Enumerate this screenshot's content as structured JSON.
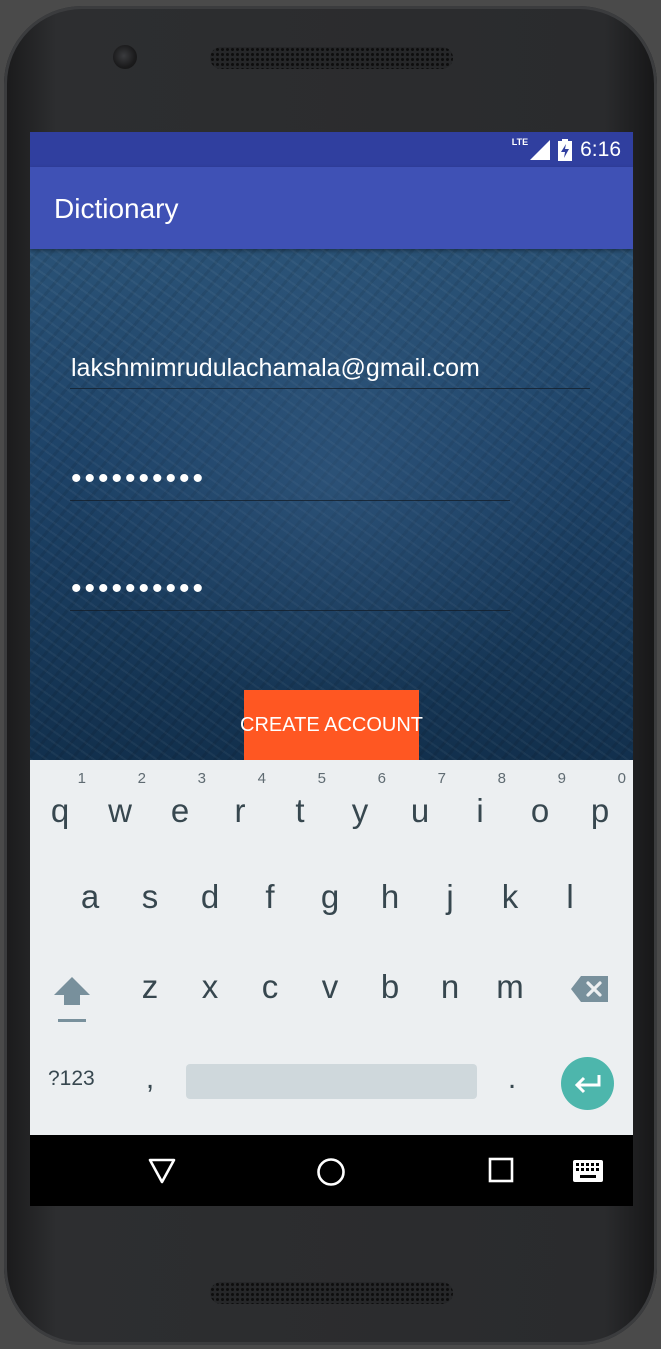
{
  "status_bar": {
    "time": "6:16",
    "network": "LTE"
  },
  "app_bar": {
    "title": "Dictionary"
  },
  "form": {
    "email_value": "lakshmimrudulachamala@gmail.com",
    "password_value": "••••••••••",
    "confirm_password_value": "••••••••••",
    "create_button_label": "CREATE ACCOUNT"
  },
  "keyboard": {
    "row1": [
      {
        "key": "q",
        "hint": "1"
      },
      {
        "key": "w",
        "hint": "2"
      },
      {
        "key": "e",
        "hint": "3"
      },
      {
        "key": "r",
        "hint": "4"
      },
      {
        "key": "t",
        "hint": "5"
      },
      {
        "key": "y",
        "hint": "6"
      },
      {
        "key": "u",
        "hint": "7"
      },
      {
        "key": "i",
        "hint": "8"
      },
      {
        "key": "o",
        "hint": "9"
      },
      {
        "key": "p",
        "hint": "0"
      }
    ],
    "row2": [
      "a",
      "s",
      "d",
      "f",
      "g",
      "h",
      "j",
      "k",
      "l"
    ],
    "row3": [
      "z",
      "x",
      "c",
      "v",
      "b",
      "n",
      "m"
    ],
    "symbols_label": "?123",
    "comma": ",",
    "period": "."
  },
  "colors": {
    "status_bar": "#303f9f",
    "app_bar": "#3f51b5",
    "button": "#ff5722",
    "enter_key": "#4db6ac",
    "keyboard_bg": "#eceff1"
  },
  "icons": [
    "signal-icon",
    "battery-charging-icon",
    "shift-icon",
    "backspace-icon",
    "enter-icon",
    "back-icon",
    "home-icon",
    "recents-icon",
    "keyboard-icon"
  ]
}
